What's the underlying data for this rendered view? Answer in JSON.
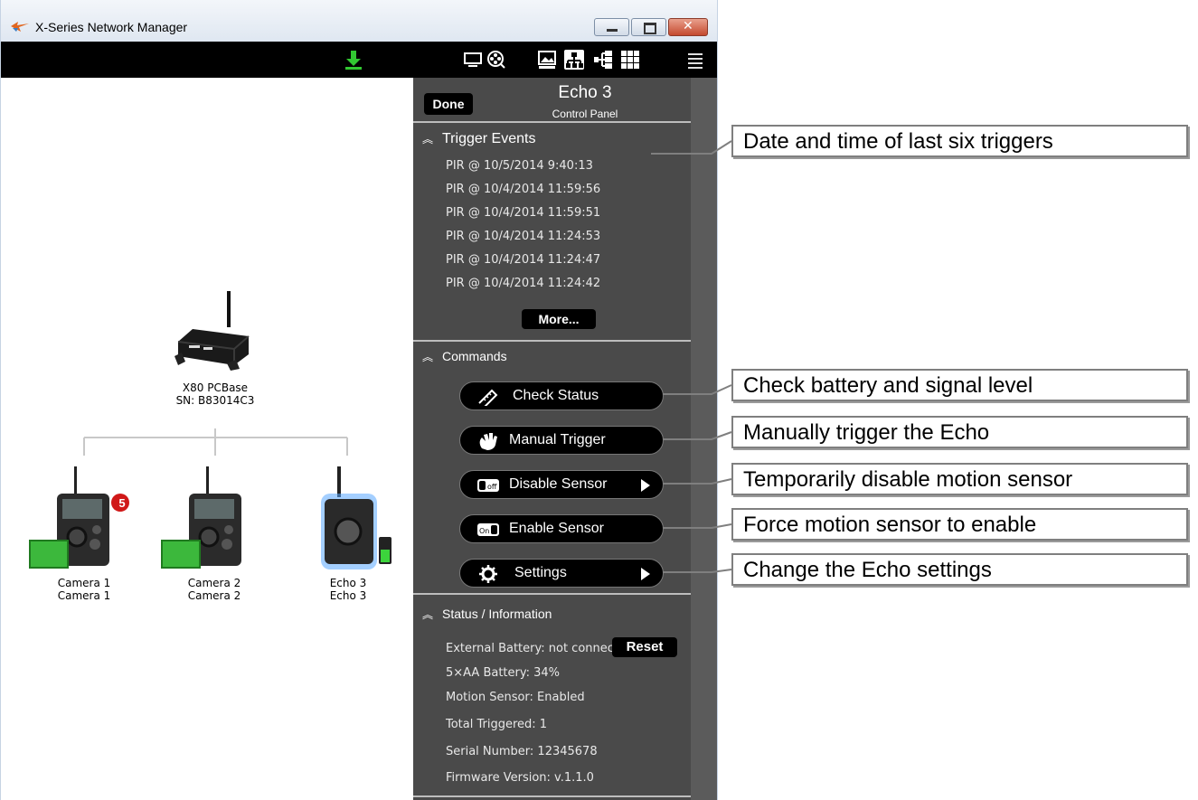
{
  "window": {
    "title": "X-Series Network Manager"
  },
  "toolbar": {
    "icons": [
      "download-icon",
      "monitor-icon",
      "film-reel-icon",
      "image-icon",
      "network-icon",
      "tree-icon",
      "grid-icon",
      "menu-icon"
    ],
    "accent": "#32c832"
  },
  "network": {
    "base": {
      "name": "X80 PCBase",
      "serial": "SN: B83014C3"
    },
    "devices": [
      {
        "name": "Camera 1",
        "sub": "Camera 1",
        "badge": "5"
      },
      {
        "name": "Camera 2",
        "sub": "Camera 2"
      },
      {
        "name": "Echo 3",
        "sub": "Echo 3"
      }
    ]
  },
  "panel": {
    "done_label": "Done",
    "title": "Echo 3",
    "subtitle": "Control Panel",
    "trigger_section": "Trigger Events",
    "events": [
      "PIR @ 10/5/2014 9:40:13",
      "PIR @ 10/4/2014 11:59:56",
      "PIR @ 10/4/2014 11:59:51",
      "PIR @ 10/4/2014 11:24:53",
      "PIR @ 10/4/2014 11:24:47",
      "PIR @ 10/4/2014 11:24:42"
    ],
    "more_label": "More...",
    "commands_section": "Commands",
    "commands": [
      "Check Status",
      "Manual Trigger",
      "Disable Sensor",
      "Enable Sensor",
      "Settings"
    ],
    "status_section": "Status / Information",
    "status": {
      "external_battery": "External Battery:  not connected",
      "aa_battery": "5×AA Battery:  34%",
      "motion_sensor": "Motion Sensor:  Enabled",
      "total_triggered": "Total Triggered:  1",
      "serial": "Serial Number: 12345678",
      "firmware": "Firmware Version: v.1.1.0"
    },
    "reset_label": "Reset"
  },
  "callouts": [
    "Date and time of last six triggers",
    "Check battery and signal level",
    "Manually trigger the Echo",
    "Temporarily disable motion sensor",
    "Force motion sensor to enable",
    "Change the Echo settings"
  ]
}
